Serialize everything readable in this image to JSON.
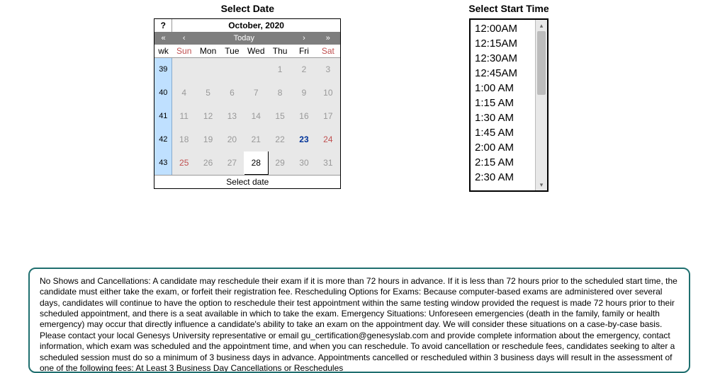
{
  "selectDate": {
    "heading": "Select Date",
    "help": "?",
    "monthYear": "October, 2020",
    "nav": {
      "prevYear": "«",
      "prevMonth": "‹",
      "today": "Today",
      "nextMonth": "›",
      "nextYear": "»"
    },
    "wkLabel": "wk",
    "dayHeaders": [
      "Sun",
      "Mon",
      "Tue",
      "Wed",
      "Thu",
      "Fri",
      "Sat"
    ],
    "rows": [
      {
        "wk": "39",
        "days": [
          {
            "n": "",
            "t": "blank"
          },
          {
            "n": "",
            "t": "blank"
          },
          {
            "n": "",
            "t": "blank"
          },
          {
            "n": "",
            "t": "blank"
          },
          {
            "n": "1",
            "t": "out"
          },
          {
            "n": "2",
            "t": "out"
          },
          {
            "n": "3",
            "t": "out"
          }
        ]
      },
      {
        "wk": "40",
        "days": [
          {
            "n": "4",
            "t": "out"
          },
          {
            "n": "5",
            "t": "out"
          },
          {
            "n": "6",
            "t": "out"
          },
          {
            "n": "7",
            "t": "out"
          },
          {
            "n": "8",
            "t": "out"
          },
          {
            "n": "9",
            "t": "out"
          },
          {
            "n": "10",
            "t": "out"
          }
        ]
      },
      {
        "wk": "41",
        "days": [
          {
            "n": "11",
            "t": "out"
          },
          {
            "n": "12",
            "t": "out"
          },
          {
            "n": "13",
            "t": "out"
          },
          {
            "n": "14",
            "t": "out"
          },
          {
            "n": "15",
            "t": "out"
          },
          {
            "n": "16",
            "t": "out"
          },
          {
            "n": "17",
            "t": "out"
          }
        ]
      },
      {
        "wk": "42",
        "days": [
          {
            "n": "18",
            "t": "out"
          },
          {
            "n": "19",
            "t": "out"
          },
          {
            "n": "20",
            "t": "out"
          },
          {
            "n": "21",
            "t": "out"
          },
          {
            "n": "22",
            "t": "out"
          },
          {
            "n": "23",
            "t": "hl"
          },
          {
            "n": "24",
            "t": "we"
          }
        ]
      },
      {
        "wk": "43",
        "days": [
          {
            "n": "25",
            "t": "we"
          },
          {
            "n": "26",
            "t": "out"
          },
          {
            "n": "27",
            "t": "out"
          },
          {
            "n": "28",
            "t": "today"
          },
          {
            "n": "29",
            "t": "out"
          },
          {
            "n": "30",
            "t": "out"
          },
          {
            "n": "31",
            "t": "out"
          }
        ]
      }
    ],
    "footer": "Select date"
  },
  "selectTime": {
    "heading": "Select Start Time",
    "items": [
      "12:00AM",
      "12:15AM",
      "12:30AM",
      "12:45AM",
      "1:00 AM",
      "1:15 AM",
      "1:30 AM",
      "1:45 AM",
      "2:00 AM",
      "2:15 AM",
      "2:30 AM"
    ]
  },
  "policy": {
    "text": "No Shows and Cancellations: A candidate may reschedule their exam if it is more than 72 hours in advance. If it is less than 72 hours prior to the scheduled start time, the candidate must either take the exam, or forfeit their registration fee. Rescheduling Options for Exams: Because computer-based exams are administered over several days, candidates will continue to have the option to reschedule their test appointment within the same testing window provided the request is made 72 hours prior to their scheduled appointment, and there is a seat available in which to take the exam. Emergency Situations: Unforeseen emergencies (death in the family, family or health emergency) may occur that directly influence a candidate's ability to take an exam on the appointment day. We will consider these situations on a case-by-case basis. Please contact your local Genesys University representative or email gu_certification@genesyslab.com and provide complete information about the emergency, contact information, which exam was scheduled and the appointment time, and when you can reschedule. To avoid cancellation or reschedule fees, candidates seeking to alter a scheduled session must do so a minimum of 3 business days in advance. Appointments cancelled or rescheduled within 3 business days will result in the assessment of one of the following fees: At Least 3 Business Day Cancellations or Reschedules"
  }
}
